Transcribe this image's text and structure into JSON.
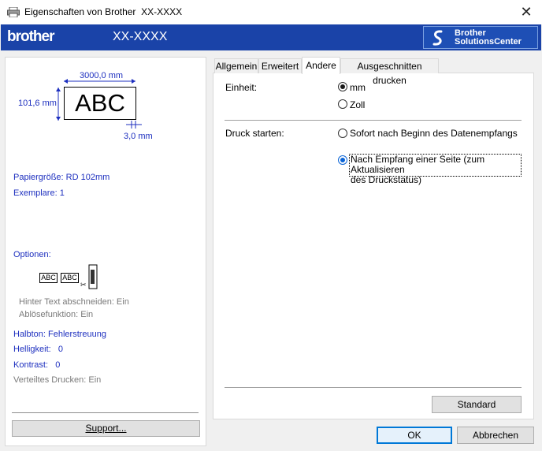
{
  "window": {
    "title_prefix": "Eigenschaften von Brother",
    "title_model": "XX-XXXX",
    "close_glyph": "✕"
  },
  "header": {
    "brand": "brother",
    "model": "XX-XXXX",
    "solutions_line1": "Brother",
    "solutions_line2": "SolutionsCenter"
  },
  "preview": {
    "width_label": "3000,0 mm",
    "height_label": "101,6 mm",
    "sample_text": "ABC",
    "margin_label": "3,0 mm"
  },
  "left_info": {
    "paper_size": "Papiergröße: RD 102mm",
    "copies": "Exemplare: 1",
    "options_label": "Optionen:",
    "option_sample": "ABC",
    "cut_after_text": "Hinter Text abschneiden: Ein",
    "peel_function": "Ablösefunktion: Ein",
    "halftone": "Halbton: Fehlerstreuung",
    "brightness": "Helligkeit:   0",
    "contrast": "Kontrast:   0",
    "distributed": "Verteiltes Drucken: Ein",
    "support_button": "Support..."
  },
  "tabs": [
    {
      "label": "Allgemein",
      "active": false
    },
    {
      "label": "Erweitert",
      "active": false
    },
    {
      "label": "Andere",
      "active": true
    },
    {
      "label": "Ausgeschnitten drucken",
      "active": false
    }
  ],
  "andere": {
    "unit_label": "Einheit:",
    "unit_options": [
      "mm",
      "Zoll"
    ],
    "unit_selected": "mm",
    "print_start_label": "Druck starten:",
    "print_start_option1": "Sofort nach Beginn des Datenempfangs",
    "print_start_option2_line1": "Nach Empfang einer Seite (zum Aktualisieren",
    "print_start_option2_line2": "des Druckstatus)",
    "print_start_selected": 2,
    "default_button": "Standard"
  },
  "footer": {
    "ok_button": "OK",
    "cancel_button": "Abbrechen"
  },
  "colors": {
    "header_bg": "#1a43a8",
    "info_text": "#1d2fbf",
    "ok_border": "#0078d7"
  }
}
